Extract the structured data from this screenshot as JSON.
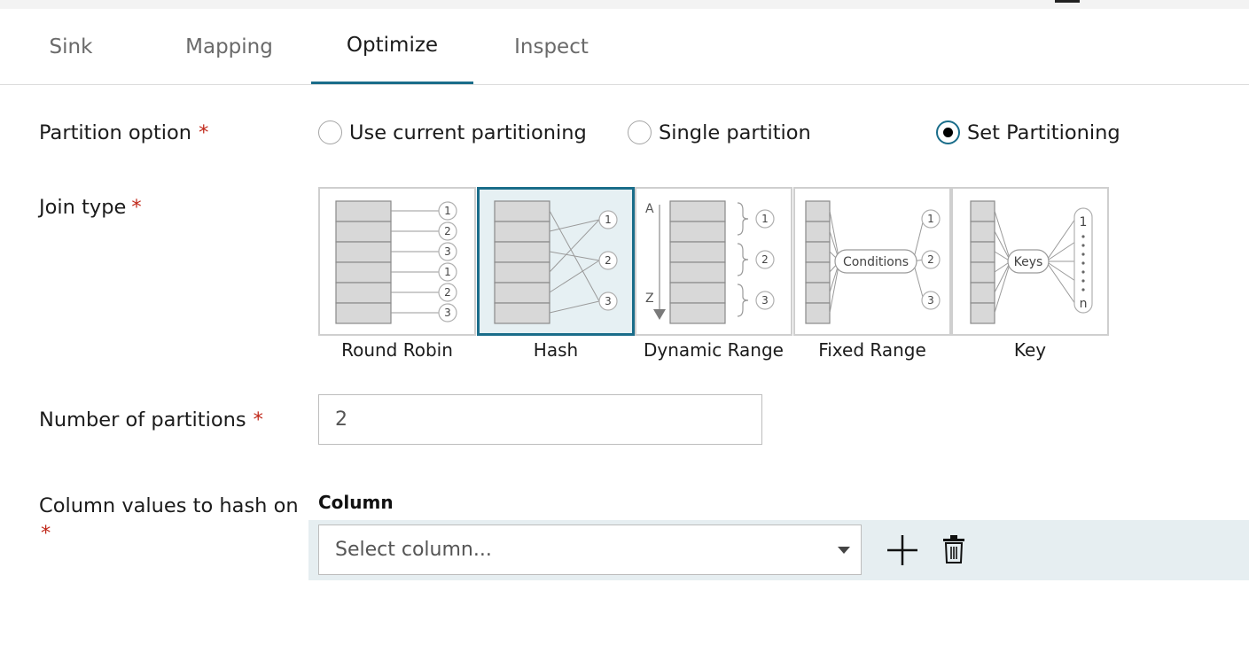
{
  "tabs": [
    {
      "label": "Sink",
      "active": false
    },
    {
      "label": "Mapping",
      "active": false
    },
    {
      "label": "Optimize",
      "active": true
    },
    {
      "label": "Inspect",
      "active": false
    }
  ],
  "partition": {
    "label": "Partition option",
    "required_mark": "*",
    "options": [
      {
        "label": "Use current partitioning",
        "checked": false
      },
      {
        "label": "Single partition",
        "checked": false
      },
      {
        "label": "Set Partitioning",
        "checked": true
      }
    ]
  },
  "join": {
    "label": "Join type",
    "required_mark": "*",
    "types": [
      {
        "label": "Round Robin",
        "selected": false
      },
      {
        "label": "Hash",
        "selected": true
      },
      {
        "label": "Dynamic Range",
        "selected": false
      },
      {
        "label": "Fixed Range",
        "selected": false
      },
      {
        "label": "Key",
        "selected": false
      }
    ],
    "diagram_text": {
      "conditions": "Conditions",
      "keys": "Keys",
      "range_start": "A",
      "range_end": "Z",
      "n": "n",
      "partition_numbers": [
        "1",
        "2",
        "3"
      ]
    }
  },
  "partitions": {
    "label": "Number of partitions",
    "required_mark": "*",
    "value": "2"
  },
  "hash_columns": {
    "label": "Column values to hash on",
    "required_mark": "*",
    "column_header": "Column",
    "select_placeholder": "Select column..."
  },
  "icons": {
    "add": "plus-icon",
    "delete": "trash-icon",
    "dropdown": "caret-down-icon"
  },
  "colors": {
    "accent": "#1a6d8a",
    "required": "#c0281a",
    "row_highlight": "#e6eef1"
  }
}
